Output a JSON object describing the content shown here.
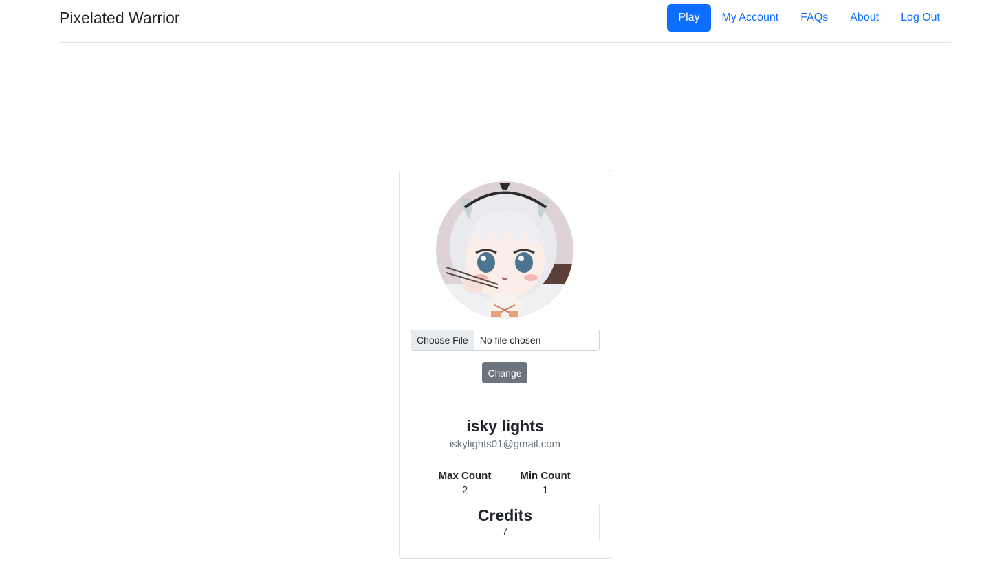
{
  "header": {
    "brand": "Pixelated Warrior",
    "nav": [
      {
        "label": "Play",
        "active": true
      },
      {
        "label": "My Account",
        "active": false
      },
      {
        "label": "FAQs",
        "active": false
      },
      {
        "label": "About",
        "active": false
      },
      {
        "label": "Log Out",
        "active": false
      }
    ]
  },
  "profile": {
    "file_button": "Choose File",
    "file_status": "No file chosen",
    "change_label": "Change",
    "name": "isky lights",
    "email": "iskylights01@gmail.com",
    "stats": [
      {
        "label": "Max Count",
        "value": "2"
      },
      {
        "label": "Min Count",
        "value": "1"
      }
    ],
    "credits": {
      "label": "Credits",
      "value": "7"
    }
  },
  "colors": {
    "primary": "#0d6efd",
    "secondary_button": "#6c757d",
    "border": "#dee2e6"
  }
}
